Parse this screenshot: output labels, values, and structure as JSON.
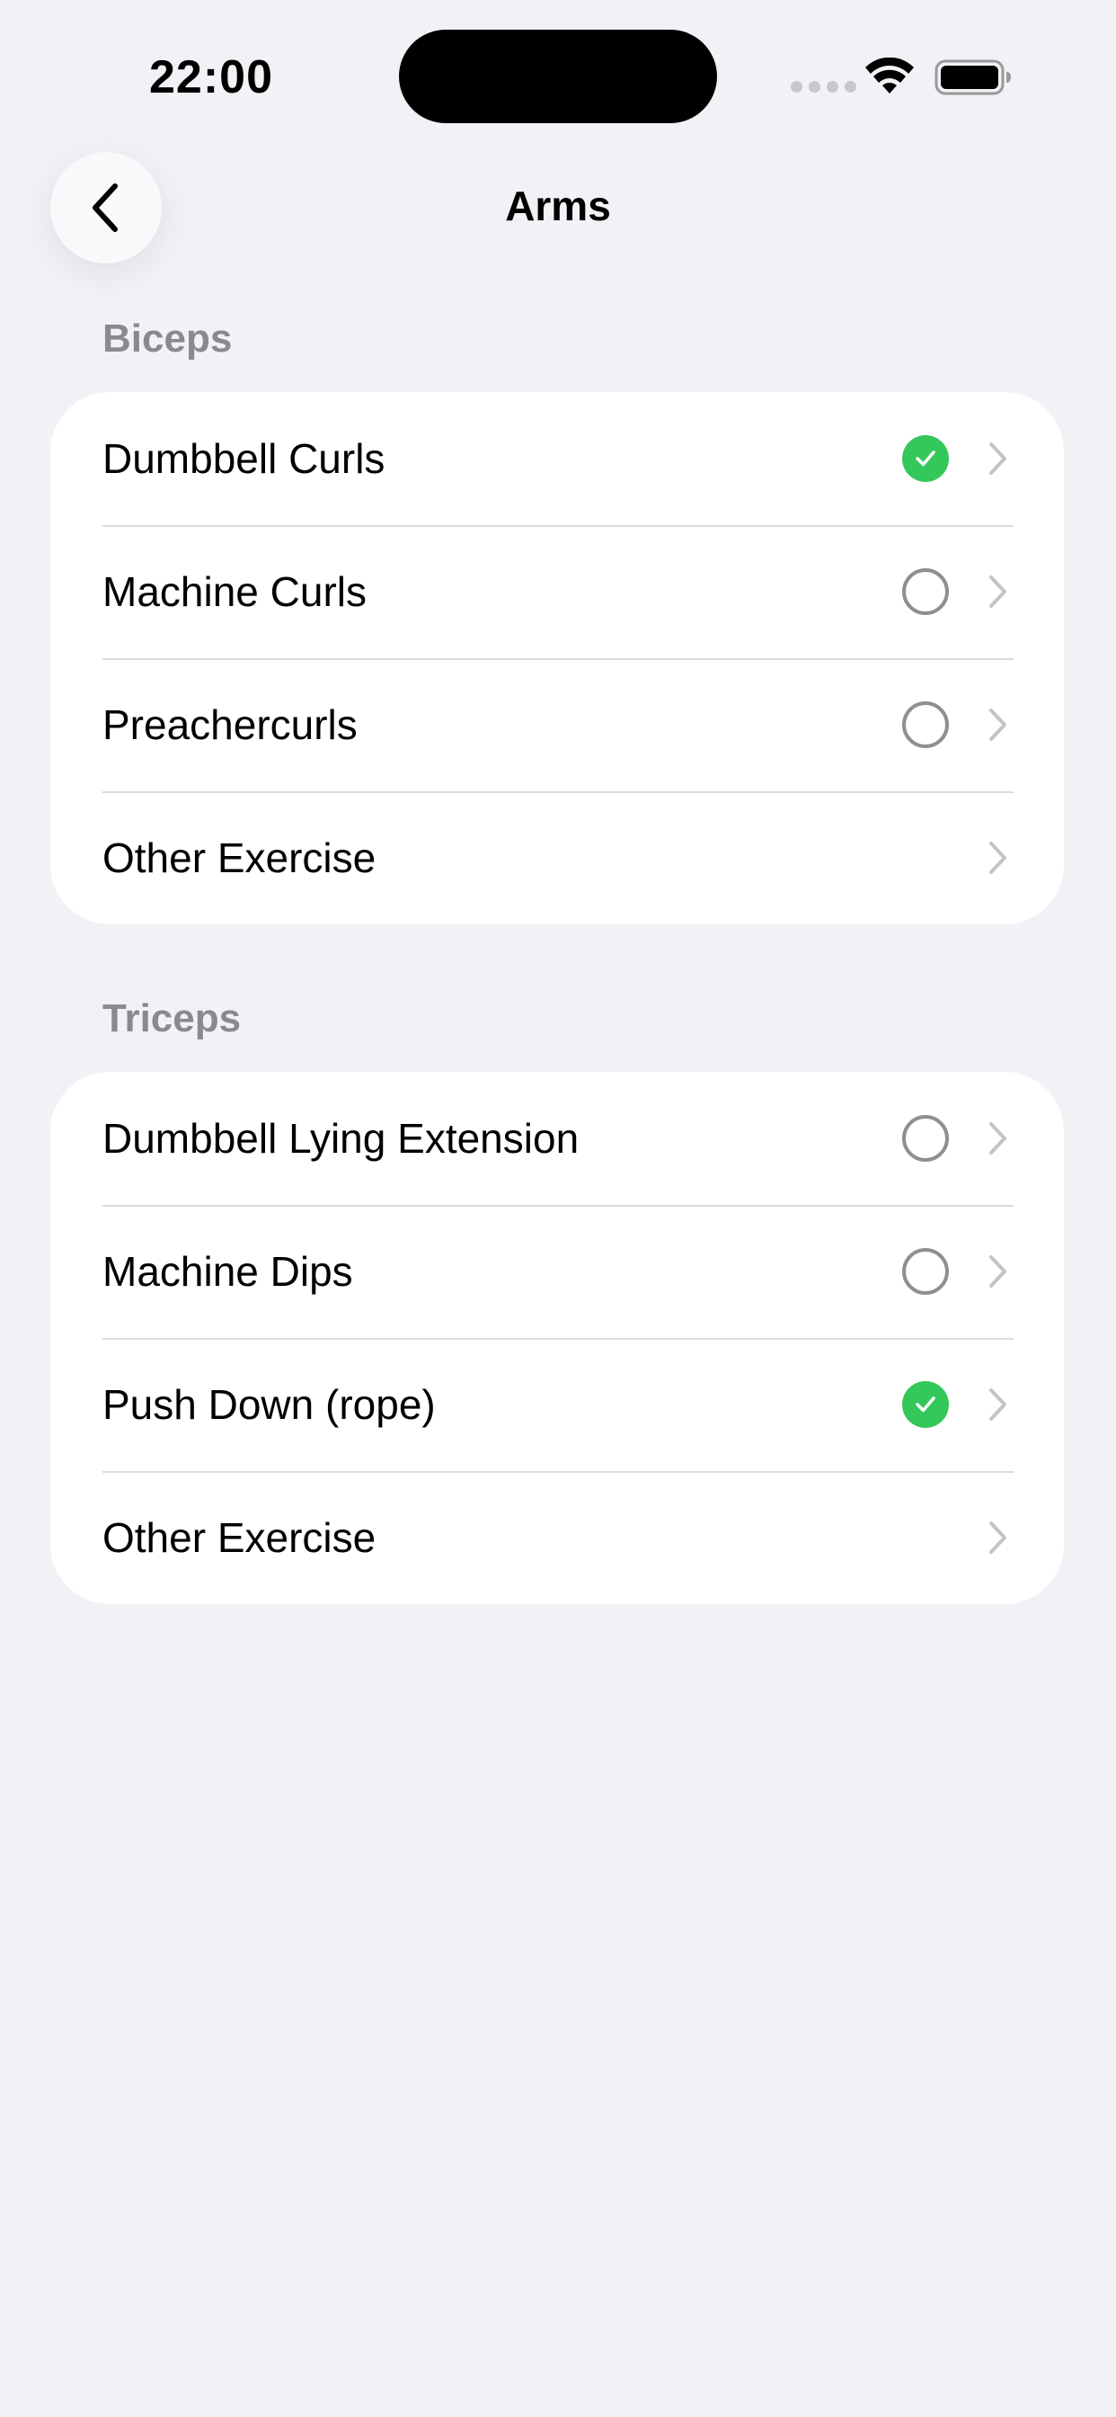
{
  "status_bar": {
    "time": "22:00"
  },
  "nav": {
    "title": "Arms",
    "back_icon": "chevron-left-icon"
  },
  "sections": [
    {
      "header": "Biceps",
      "rows": [
        {
          "label": "Dumbbell Curls",
          "status": "done"
        },
        {
          "label": "Machine Curls",
          "status": "todo"
        },
        {
          "label": "Preachercurls",
          "status": "todo"
        },
        {
          "label": "Other Exercise",
          "status": "none"
        }
      ]
    },
    {
      "header": "Triceps",
      "rows": [
        {
          "label": "Dumbbell Lying Extension",
          "status": "todo"
        },
        {
          "label": "Machine Dips",
          "status": "todo"
        },
        {
          "label": "Push Down (rope)",
          "status": "done"
        },
        {
          "label": "Other Exercise",
          "status": "none"
        }
      ]
    }
  ],
  "colors": {
    "background": "#f2f1f6",
    "card": "#ffffff",
    "check_green": "#34c759",
    "secondary_text": "#8a8a8e",
    "chevron": "#c4c4c7"
  }
}
